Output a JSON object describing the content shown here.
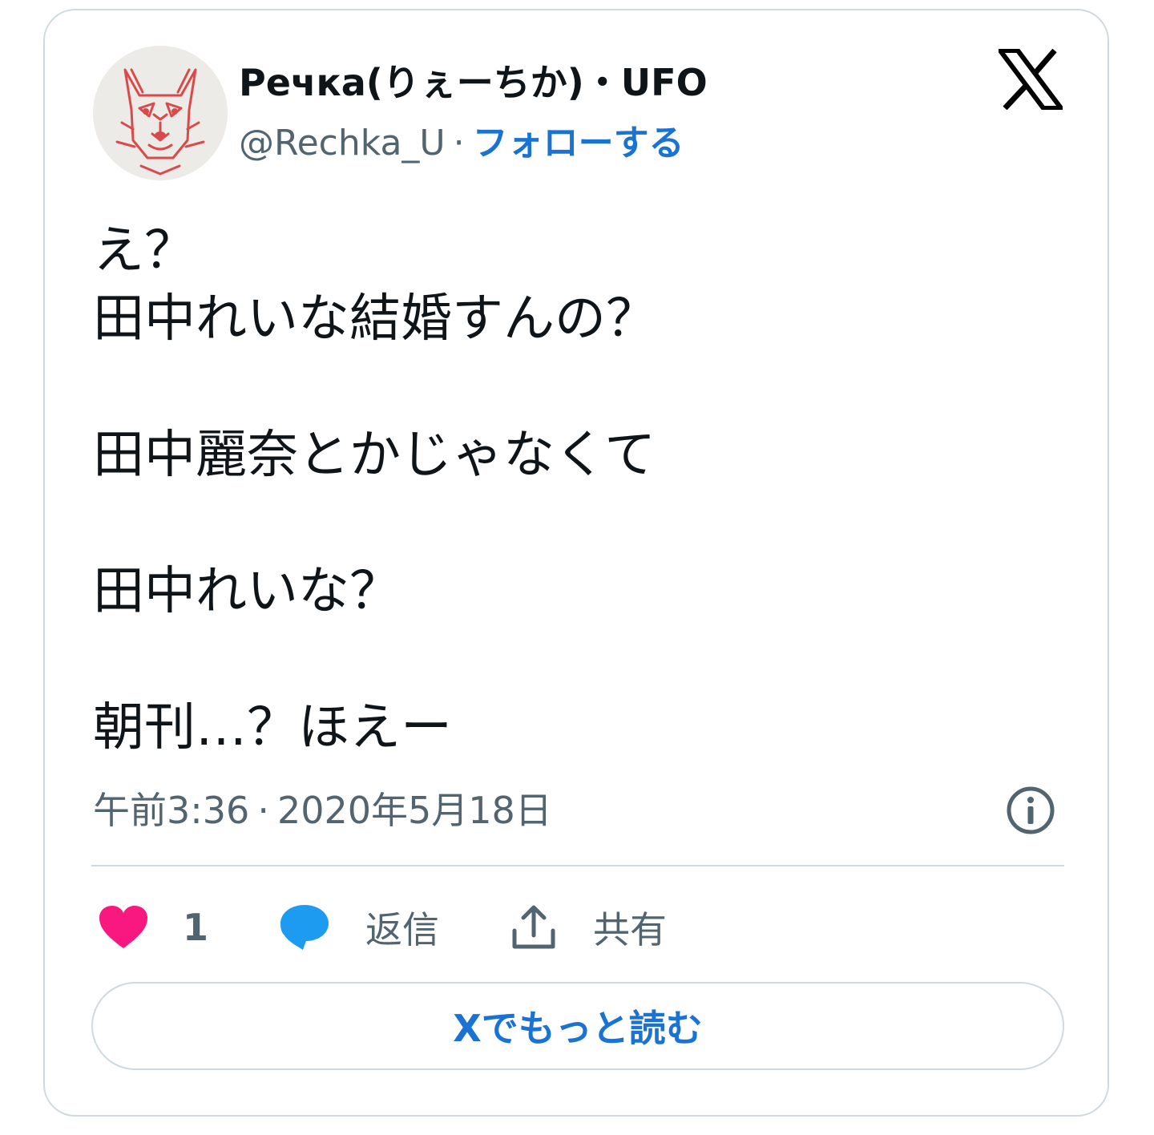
{
  "user": {
    "display_name": "Речка(りぇーちか)・UFO",
    "handle": "@Rechka_U",
    "separator": "·",
    "follow_label": "フォローする"
  },
  "tweet": {
    "lines": [
      "え？",
      "田中れいな結婚すんの？",
      "",
      "田中麗奈とかじゃなくて",
      "",
      "田中れいな？",
      "",
      "朝刊…？ほえー"
    ],
    "time": "午前3:36",
    "date_separator": "·",
    "date": "2020年5月18日"
  },
  "actions": {
    "like_count": "1",
    "reply_label": "返信",
    "share_label": "共有"
  },
  "read_more_label": "Xでもっと読む",
  "icons": {
    "brand": "x-logo-icon",
    "info": "info-icon",
    "like": "heart-icon",
    "reply": "speech-bubble-icon",
    "share": "share-upload-icon"
  },
  "colors": {
    "like": "#f91880",
    "reply": "#1d9bf0",
    "link": "#1a73d2",
    "muted": "#536471",
    "border": "#cfd9de"
  }
}
